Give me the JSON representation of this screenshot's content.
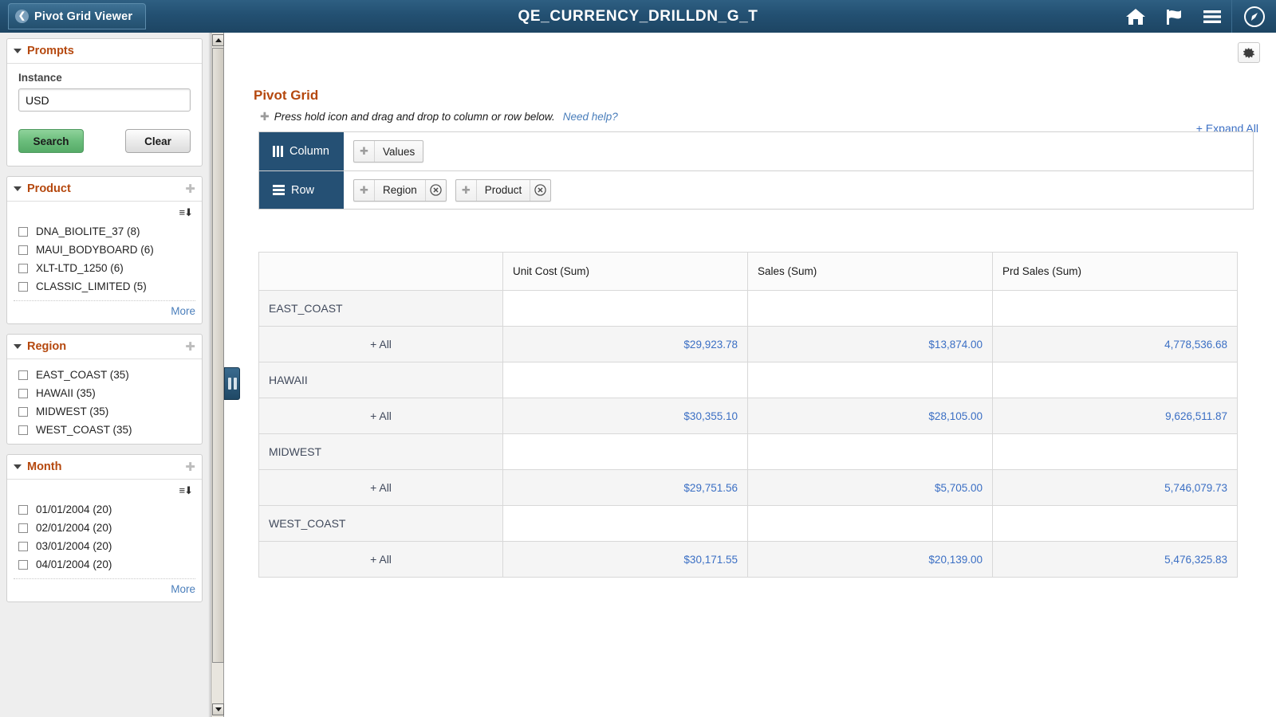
{
  "header": {
    "back_label": "Pivot Grid Viewer",
    "title": "QE_CURRENCY_DRILLDN_G_T",
    "icons": [
      "home-icon",
      "flag-icon",
      "menu-icon",
      "navigator-icon"
    ]
  },
  "sidebar": {
    "prompts": {
      "title": "Prompts",
      "field_label": "Instance",
      "field_value": "USD",
      "field_placeholder": "",
      "search_label": "Search",
      "clear_label": "Clear"
    },
    "facets": [
      {
        "title": "Product",
        "has_sort": true,
        "items": [
          "DNA_BIOLITE_37 (8)",
          "MAUI_BODYBOARD (6)",
          "XLT-LTD_1250 (6)",
          "CLASSIC_LIMITED (5)"
        ],
        "more_label": "More"
      },
      {
        "title": "Region",
        "has_sort": false,
        "items": [
          "EAST_COAST (35)",
          "HAWAII (35)",
          "MIDWEST (35)",
          "WEST_COAST (35)"
        ],
        "more_label": ""
      },
      {
        "title": "Month",
        "has_sort": true,
        "items": [
          "01/01/2004 (20)",
          "02/01/2004 (20)",
          "03/01/2004 (20)",
          "04/01/2004 (20)"
        ],
        "more_label": "More"
      }
    ]
  },
  "main": {
    "pivot_title": "Pivot Grid",
    "hint": "Press hold icon and drag and drop to column or row below.",
    "need_help": "Need help?",
    "expand_all": "+ Expand All",
    "dropzone": {
      "column_label": "Column",
      "row_label": "Row",
      "column_chips": [
        "Values"
      ],
      "row_chips": [
        "Region",
        "Product"
      ]
    }
  },
  "chart_data": {
    "type": "table",
    "title": "Pivot Grid",
    "columns": [
      "",
      "Unit Cost (Sum)",
      "Sales (Sum)",
      "Prd Sales (Sum)"
    ],
    "rows": [
      {
        "label": "EAST_COAST",
        "type": "group",
        "values": [
          "",
          "",
          ""
        ]
      },
      {
        "label": "+ All",
        "type": "all",
        "values": [
          "$29,923.78",
          "$13,874.00",
          "4,778,536.68"
        ]
      },
      {
        "label": "HAWAII",
        "type": "group",
        "values": [
          "",
          "",
          ""
        ]
      },
      {
        "label": "+ All",
        "type": "all",
        "values": [
          "$30,355.10",
          "$28,105.00",
          "9,626,511.87"
        ]
      },
      {
        "label": "MIDWEST",
        "type": "group",
        "values": [
          "",
          "",
          ""
        ]
      },
      {
        "label": "+ All",
        "type": "all",
        "values": [
          "$29,751.56",
          "$5,705.00",
          "5,746,079.73"
        ]
      },
      {
        "label": "WEST_COAST",
        "type": "group",
        "values": [
          "",
          "",
          ""
        ]
      },
      {
        "label": "+ All",
        "type": "all",
        "values": [
          "$30,171.55",
          "$20,139.00",
          "5,476,325.83"
        ]
      }
    ],
    "categories": [
      "EAST_COAST",
      "HAWAII",
      "MIDWEST",
      "WEST_COAST"
    ],
    "series": [
      {
        "name": "Unit Cost (Sum)",
        "values": [
          29923.78,
          30355.1,
          29751.56,
          30171.55
        ]
      },
      {
        "name": "Sales (Sum)",
        "values": [
          13874.0,
          28105.0,
          5705.0,
          20139.0
        ]
      },
      {
        "name": "Prd Sales (Sum)",
        "values": [
          4778536.68,
          9626511.87,
          5746079.73,
          5476325.83
        ]
      }
    ]
  },
  "colors": {
    "header_blue": "#235072",
    "accent_orange": "#b5480e",
    "link_blue": "#3b6fc4",
    "panel_blue": "#255074"
  }
}
